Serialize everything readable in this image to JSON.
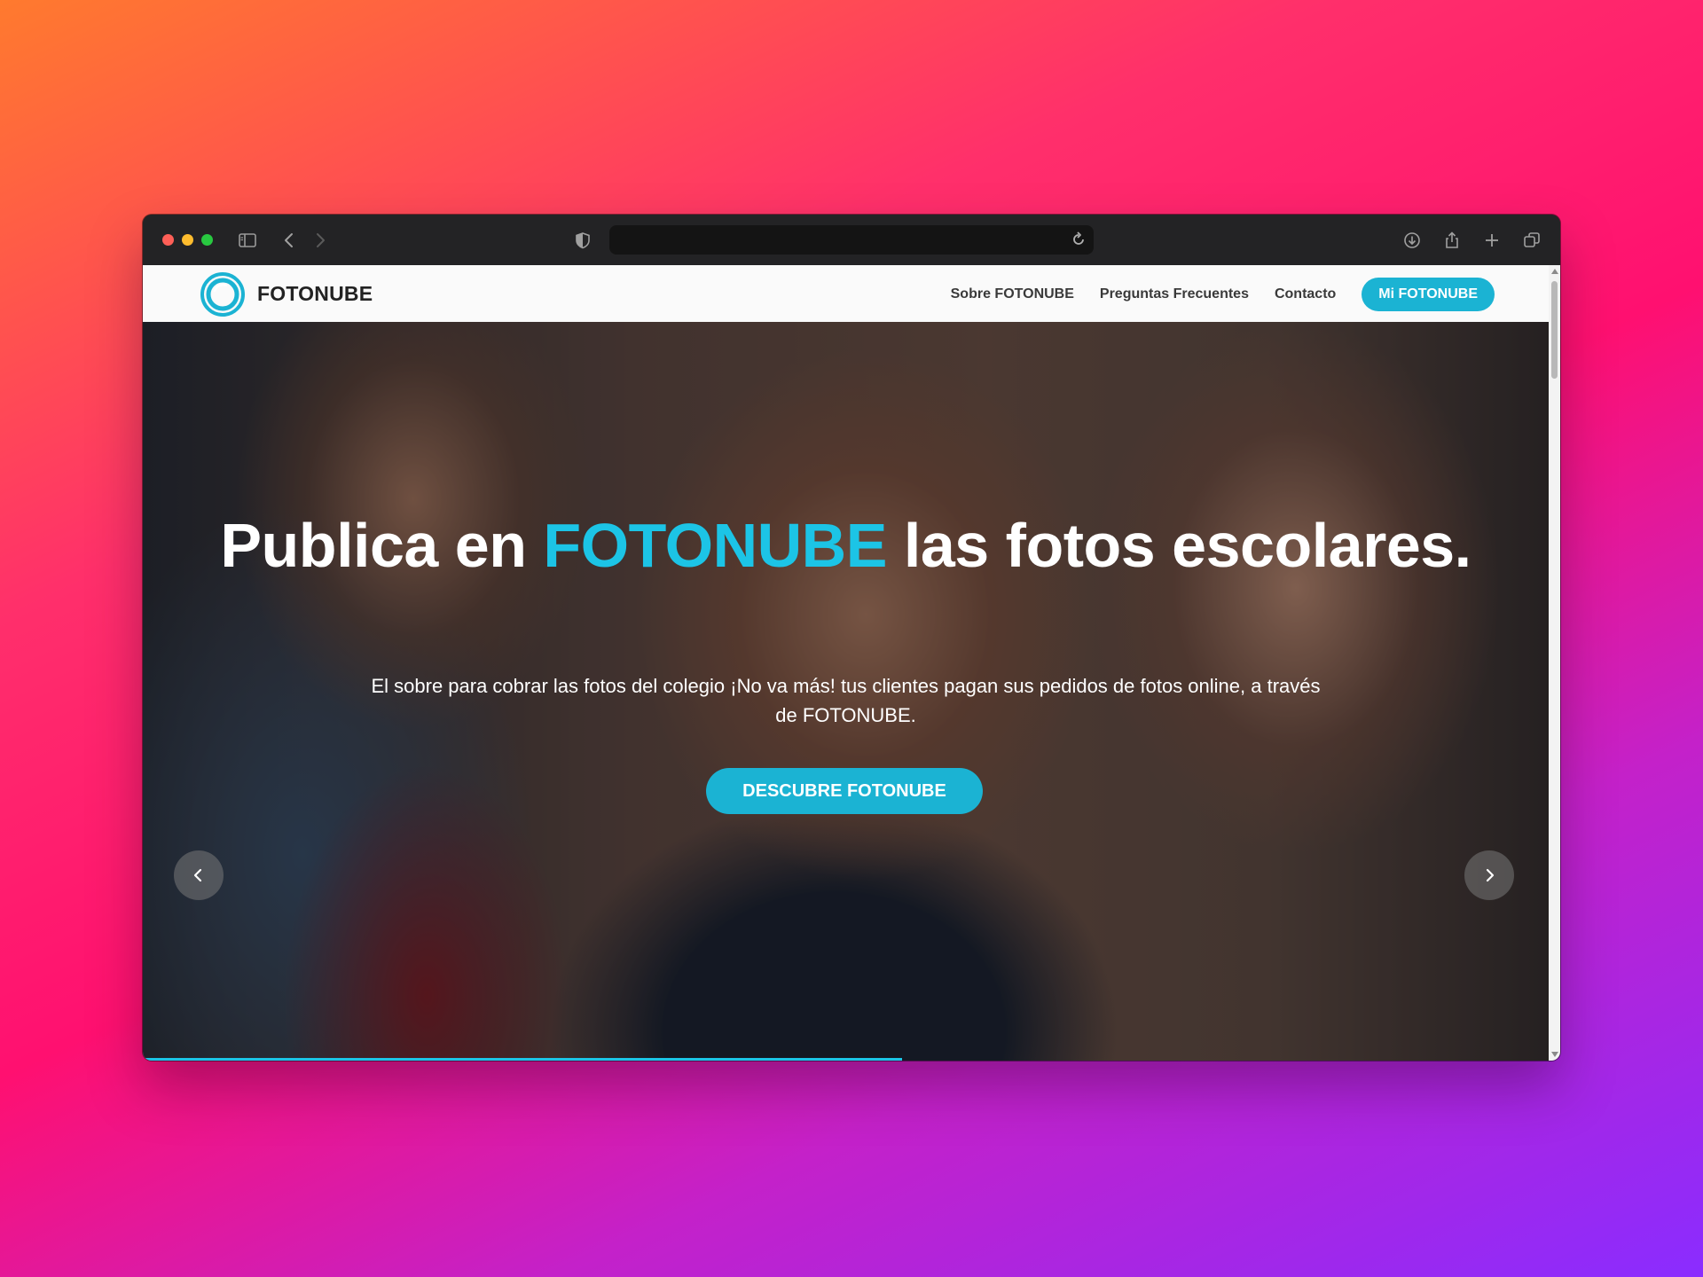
{
  "site": {
    "brand": "FOTONUBE",
    "nav": [
      {
        "label": "Sobre FOTONUBE"
      },
      {
        "label": "Preguntas Frecuentes"
      },
      {
        "label": "Contacto"
      }
    ],
    "cta_label": "Mi FOTONUBE"
  },
  "hero": {
    "title_before": "Publica en ",
    "title_accent": "FOTONUBE",
    "title_after": " las fotos escolares.",
    "subtitle": "El sobre para cobrar las fotos del colegio ¡No va más! tus clientes pagan sus pedidos de fotos online, a través de FOTONUBE.",
    "button_label": "DESCUBRE FOTONUBE",
    "slides_count": 4,
    "active_slide_index": 2,
    "slide_progress": 0.54
  },
  "colors": {
    "accent": "#1bb3d3",
    "accent_light": "#1cc4e6",
    "browser_chrome": "#232325"
  },
  "icons": [
    "sidebar-icon",
    "back-icon",
    "forward-icon",
    "shield-icon",
    "reload-icon",
    "download-icon",
    "share-icon",
    "new-tab-icon",
    "tabs-overview-icon",
    "fotonube-logo-icon",
    "chevron-left-icon",
    "chevron-right-icon"
  ]
}
